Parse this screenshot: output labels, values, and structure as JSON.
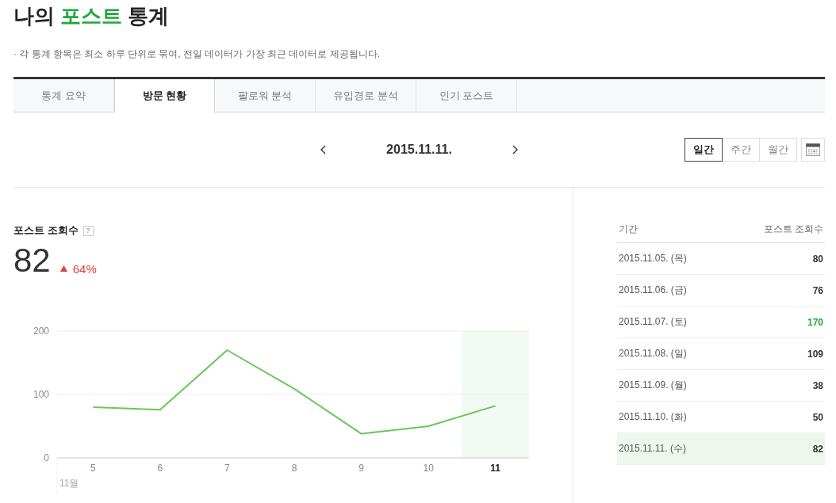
{
  "title": {
    "before": "나의",
    "highlight": "포스트",
    "after": "통계"
  },
  "note": "· 각 통계 항목은 최소 하루 단위로 묶여, 전일 데이터가 가장 최근 데이터로 제공됩니다.",
  "tabs": [
    {
      "label": "통계 요약",
      "selected": false
    },
    {
      "label": "방문 현황",
      "selected": true
    },
    {
      "label": "팔로워 분석",
      "selected": false
    },
    {
      "label": "유입경로 분석",
      "selected": false
    },
    {
      "label": "인기 포스트",
      "selected": false
    }
  ],
  "date": "2015.11.11.",
  "period_options": [
    {
      "label": "일간",
      "selected": true
    },
    {
      "label": "주간",
      "selected": false
    },
    {
      "label": "월간",
      "selected": false
    }
  ],
  "metric": {
    "title": "포스트 조회수",
    "help": "?",
    "value": "82",
    "increase": true,
    "change": "64%"
  },
  "chart": {
    "chart_data": {
      "type": "line",
      "categories": [
        "5",
        "6",
        "7",
        "8",
        "9",
        "10",
        "11"
      ],
      "series": [
        {
          "color": "#6cc55a",
          "values": [
            80,
            76,
            170,
            109,
            38,
            50,
            82
          ]
        }
      ],
      "ylim": [
        0,
        200
      ],
      "yticks": [
        0,
        100,
        200
      ],
      "annotations": [
        {
          "text": "11월"
        }
      ]
    }
  },
  "table": {
    "columns": [
      "기간",
      "포스트 조회수"
    ],
    "rows": [
      {
        "date": "2015.11.05. (목)",
        "views": "80",
        "selected": false,
        "peak": false
      },
      {
        "date": "2015.11.06. (금)",
        "views": "76",
        "selected": false,
        "peak": false
      },
      {
        "date": "2015.11.07. (토)",
        "views": "170",
        "selected": false,
        "peak": true
      },
      {
        "date": "2015.11.08. (일)",
        "views": "109",
        "selected": false,
        "peak": false
      },
      {
        "date": "2015.11.09. (월)",
        "views": "38",
        "selected": false,
        "peak": false
      },
      {
        "date": "2015.11.10. (화)",
        "views": "50",
        "selected": false,
        "peak": false
      },
      {
        "date": "2015.11.11. (수)",
        "views": "82",
        "selected": true,
        "peak": false
      }
    ]
  }
}
